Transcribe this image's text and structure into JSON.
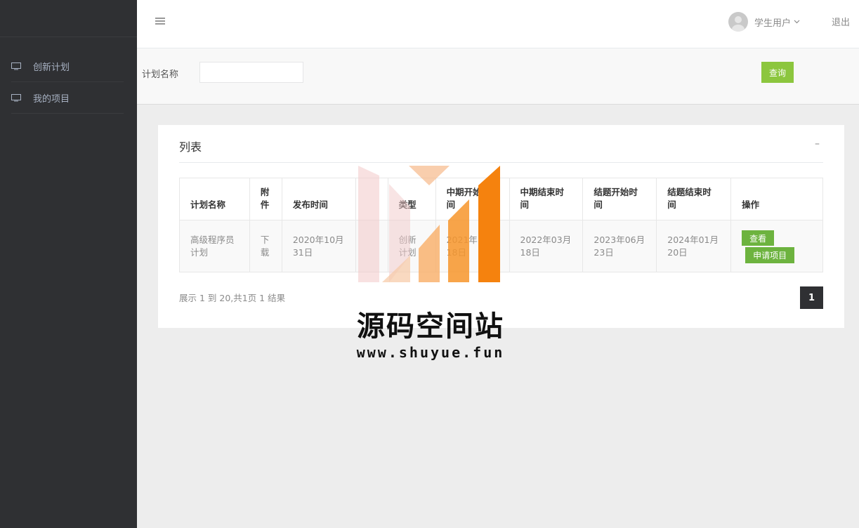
{
  "sidebar": {
    "items": [
      {
        "label": "创新计划",
        "icon": "monitor-icon"
      },
      {
        "label": "我的项目",
        "icon": "monitor-icon"
      }
    ]
  },
  "header": {
    "user_name": "学生用户",
    "logout_label": "退出"
  },
  "search": {
    "label": "计划名称",
    "value": "",
    "button_label": "查询"
  },
  "panel": {
    "title": "列表",
    "collapse_label": "–"
  },
  "table": {
    "headers": [
      "计划名称",
      "附件",
      "发布时间",
      "",
      "类型",
      "中期开始时间",
      "中期结束时间",
      "结题开始时间",
      "结题结束时间",
      "操作"
    ],
    "rows": [
      {
        "name": "高级程序员计划",
        "attachment": "下载",
        "publish_time": "2020年10月31日",
        "blank": "",
        "type": "创新计划",
        "mid_start": "2021年11月18日",
        "mid_end": "2022年03月18日",
        "final_start": "2023年06月23日",
        "final_end": "2024年01月20日",
        "view_label": "查看",
        "apply_label": "申请项目"
      }
    ]
  },
  "pagination": {
    "info": "展示 1 到 20,共1页 1 结果",
    "current_page": "1"
  },
  "watermark": {
    "title": "源码空间站",
    "url": "www.shuyue.fun"
  },
  "colors": {
    "sidebar_bg": "#2f3033",
    "accent_green": "#8cc63e",
    "button_green": "#6db33f"
  }
}
